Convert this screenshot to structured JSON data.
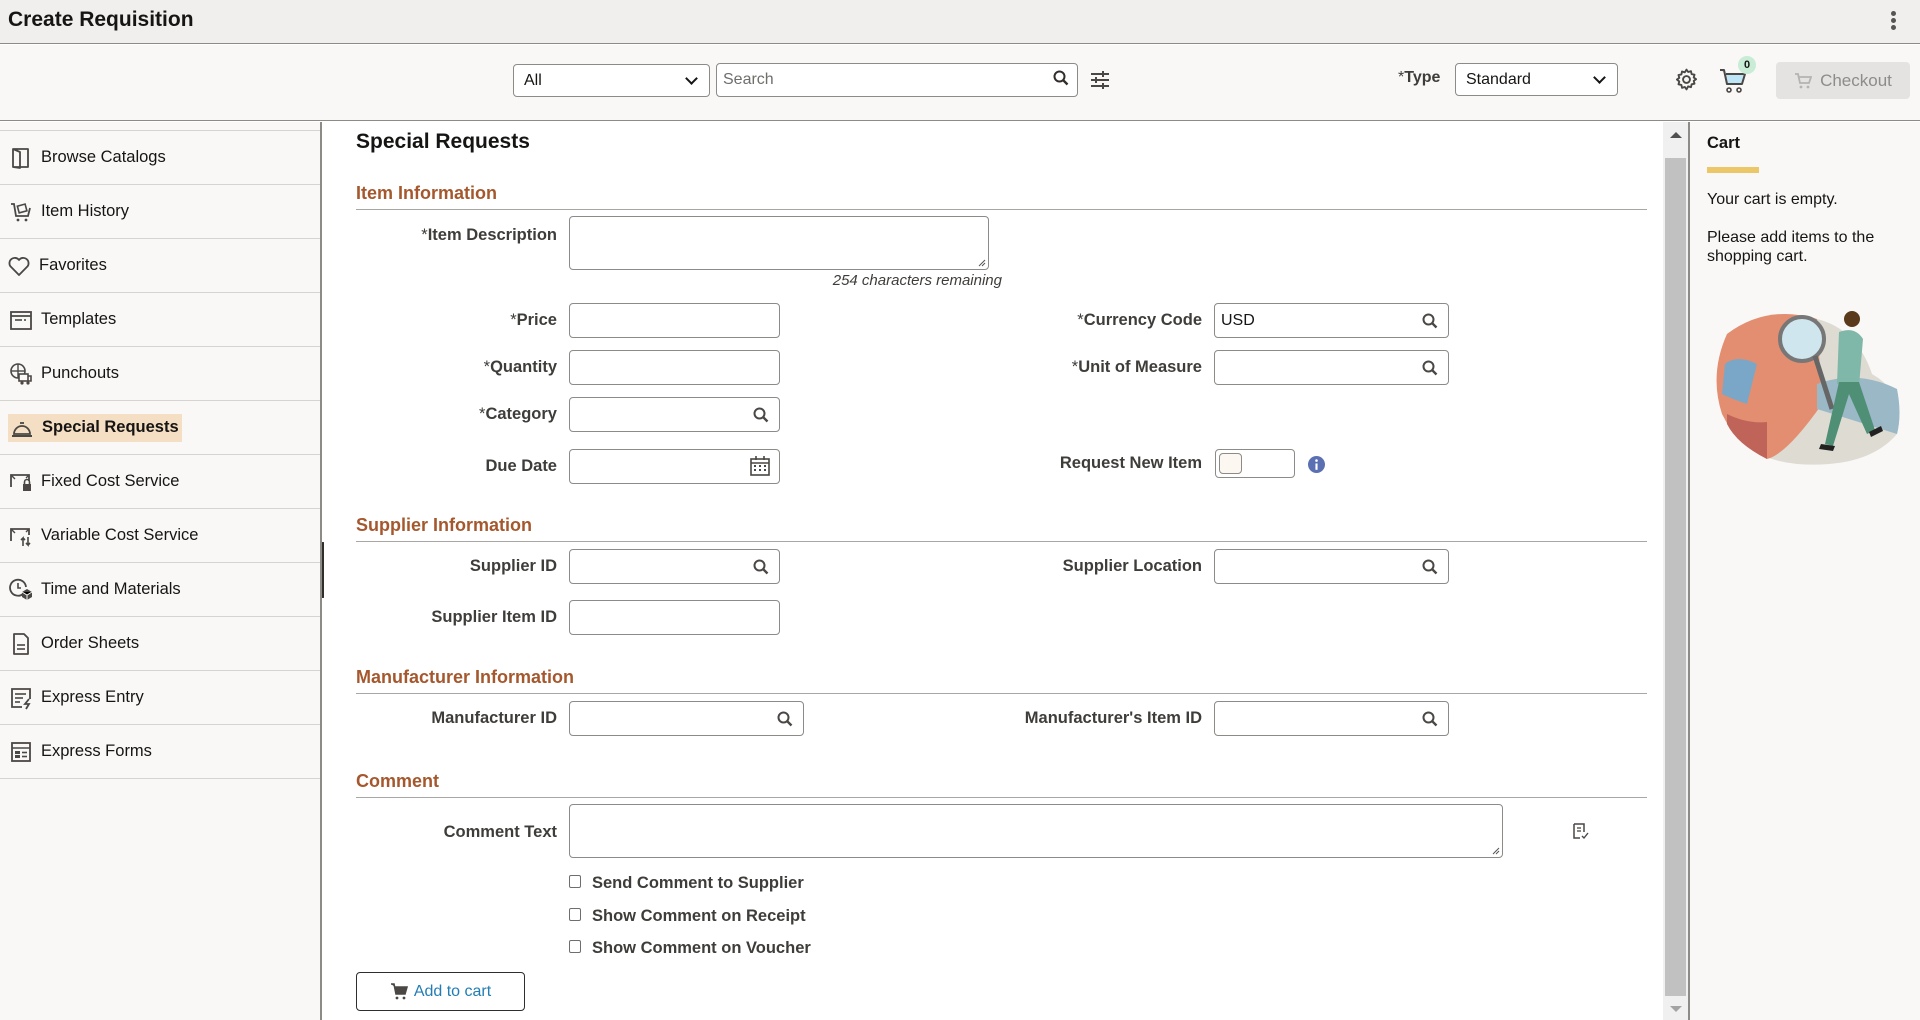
{
  "header": {
    "title": "Create Requisition",
    "more_icon": "kebab-menu-icon"
  },
  "toolbar": {
    "scope_select": {
      "value": "All"
    },
    "search": {
      "placeholder": "Search",
      "value": ""
    },
    "type_label_required": "*",
    "type_label": "Type",
    "type_select": {
      "value": "Standard"
    },
    "cart_count": "0",
    "checkout_label": "Checkout",
    "checkout_enabled": false
  },
  "sidebar": {
    "items": [
      {
        "label": "Browse Catalogs",
        "icon": "book-icon",
        "active": false
      },
      {
        "label": "Item History",
        "icon": "cart-history-icon",
        "active": false
      },
      {
        "label": "Favorites",
        "icon": "heart-icon",
        "active": false
      },
      {
        "label": "Templates",
        "icon": "template-icon",
        "active": false
      },
      {
        "label": "Punchouts",
        "icon": "globe-truck-icon",
        "active": false
      },
      {
        "label": "Special Requests",
        "icon": "service-bell-icon",
        "active": true
      },
      {
        "label": "Fixed Cost Service",
        "icon": "fixed-cost-icon",
        "active": false
      },
      {
        "label": "Variable Cost Service",
        "icon": "variable-cost-icon",
        "active": false
      },
      {
        "label": "Time and Materials",
        "icon": "clock-box-icon",
        "active": false
      },
      {
        "label": "Order Sheets",
        "icon": "document-icon",
        "active": false
      },
      {
        "label": "Express Entry",
        "icon": "express-entry-icon",
        "active": false
      },
      {
        "label": "Express Forms",
        "icon": "form-icon",
        "active": false
      }
    ]
  },
  "main": {
    "title": "Special Requests",
    "sections": {
      "item": "Item Information",
      "supplier": "Supplier Information",
      "manufacturer": "Manufacturer Information",
      "comment": "Comment"
    },
    "fields": {
      "item_description": {
        "label": "Item Description",
        "required": "*",
        "value": "",
        "hint": "254 characters remaining"
      },
      "price": {
        "label": "Price",
        "required": "*",
        "value": ""
      },
      "quantity": {
        "label": "Quantity",
        "required": "*",
        "value": ""
      },
      "category": {
        "label": "Category",
        "required": "*",
        "value": ""
      },
      "due_date": {
        "label": "Due Date",
        "value": ""
      },
      "currency_code": {
        "label": "Currency Code",
        "required": "*",
        "value": "USD"
      },
      "unit_of_measure": {
        "label": "Unit of Measure",
        "required": "*",
        "value": ""
      },
      "request_new_item": {
        "label": "Request New Item",
        "on": false
      },
      "supplier_id": {
        "label": "Supplier ID",
        "value": ""
      },
      "supplier_location": {
        "label": "Supplier Location",
        "value": ""
      },
      "supplier_item_id": {
        "label": "Supplier Item ID",
        "value": ""
      },
      "manufacturer_id": {
        "label": "Manufacturer ID",
        "value": ""
      },
      "manufacturers_item_id": {
        "label": "Manufacturer's Item ID",
        "value": ""
      },
      "comment_text": {
        "label": "Comment Text",
        "value": ""
      }
    },
    "checkboxes": [
      {
        "label": "Send Comment to Supplier",
        "checked": false
      },
      {
        "label": "Show Comment on Receipt",
        "checked": false
      },
      {
        "label": "Show Comment on Voucher",
        "checked": false
      }
    ],
    "add_to_cart_label": "Add to cart"
  },
  "cart": {
    "title": "Cart",
    "empty_message": "Your cart is empty.",
    "instruction": "Please add items to the shopping cart."
  },
  "colors": {
    "section_header": "#a5582d",
    "active_nav_bg": "#f5dfc4",
    "cart_accent": "#ebc767",
    "link_blue": "#227db5",
    "badge_bg": "#c8ecd5"
  }
}
